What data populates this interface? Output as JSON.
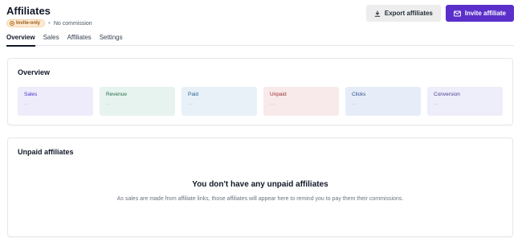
{
  "page": {
    "title": "Affiliates",
    "badge": "Invite-only",
    "commission": "No commission"
  },
  "actions": {
    "export_label": "Export affiliates",
    "invite_label": "Invite affiliate"
  },
  "tabs": [
    {
      "label": "Overview",
      "active": true
    },
    {
      "label": "Sales",
      "active": false
    },
    {
      "label": "Affiliates",
      "active": false
    },
    {
      "label": "Settings",
      "active": false
    }
  ],
  "overview": {
    "title": "Overview",
    "stats": [
      {
        "label": "Sales",
        "value": "—",
        "bg": "#eeecfb",
        "color": "#4338ca"
      },
      {
        "label": "Revenue",
        "value": "—",
        "bg": "#e7f3ef",
        "color": "#256d4c"
      },
      {
        "label": "Paid",
        "value": "—",
        "bg": "#e8f1f7",
        "color": "#2b5f8a"
      },
      {
        "label": "Unpaid",
        "value": "—",
        "bg": "#f8eaea",
        "color": "#9b2c2c"
      },
      {
        "label": "Clicks",
        "value": "—",
        "bg": "#e6edf8",
        "color": "#2c4f86"
      },
      {
        "label": "Conversion",
        "value": "—",
        "bg": "#eeedfa",
        "color": "#4a3d8f"
      }
    ]
  },
  "unpaid": {
    "title": "Unpaid affiliates",
    "empty_title": "You don't have any unpaid affiliates",
    "empty_desc": "As sales are made from affiliate links, those affiliates will appear here to remind you to pay them their commissions."
  }
}
